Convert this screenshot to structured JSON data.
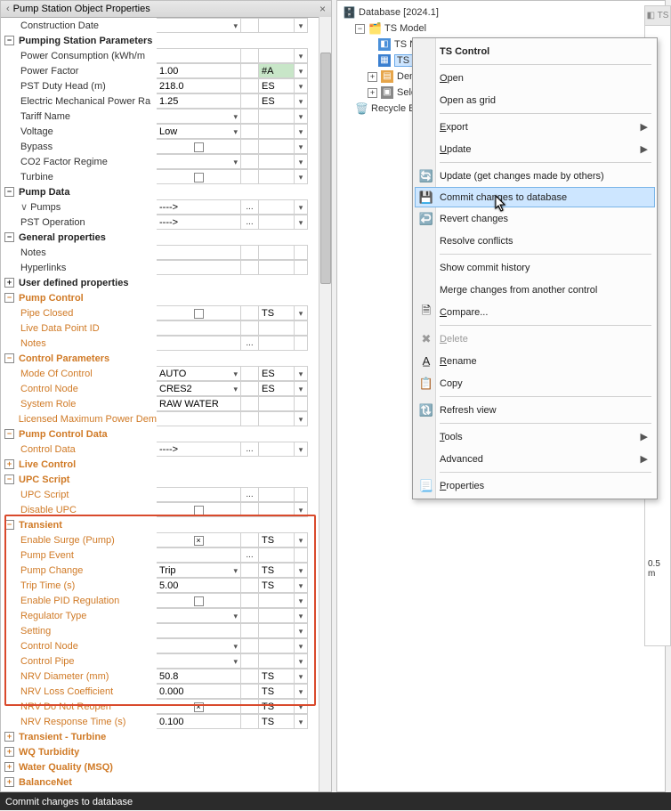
{
  "panel_title": "Pump Station Object Properties",
  "rows": [
    {
      "type": "field",
      "label": "Construction Date",
      "c1": "",
      "c1dd": true,
      "c2": "",
      "c3": "",
      "c4": true
    },
    {
      "type": "group",
      "label": "Pumping Station Parameters",
      "exp": "−"
    },
    {
      "type": "field",
      "label": "Power Consumption (kWh/m",
      "c1": "",
      "c2": "",
      "c3": "",
      "c4": true
    },
    {
      "type": "field",
      "label": "Power Factor",
      "c1": "1.00",
      "c2": "",
      "c3": "#A",
      "c3cls": "green",
      "c4": true
    },
    {
      "type": "field",
      "label": "PST Duty Head (m)",
      "c1": "218.0",
      "c2": "",
      "c3": "ES",
      "c4": true
    },
    {
      "type": "field",
      "label": "Electric Mechanical Power Ra",
      "c1": "1.25",
      "c2": "",
      "c3": "ES",
      "c4": true
    },
    {
      "type": "field",
      "label": "Tariff Name",
      "c1": "",
      "c1dd": true,
      "c2": "",
      "c3": "",
      "c4": true
    },
    {
      "type": "field",
      "label": "Voltage",
      "c1": "Low",
      "c1dd": true,
      "c2": "",
      "c3": "",
      "c4": true
    },
    {
      "type": "field",
      "label": "Bypass",
      "c1": "",
      "check": true,
      "c2": "",
      "c3": "",
      "c4": true
    },
    {
      "type": "field",
      "label": "CO2 Factor Regime",
      "c1": "",
      "c1dd": true,
      "c2": "",
      "c3": "",
      "c4": true
    },
    {
      "type": "field",
      "label": "Turbine",
      "c1": "",
      "check": true,
      "c2": "",
      "c3": "",
      "c4": true
    },
    {
      "type": "group",
      "label": "Pump Data",
      "exp": "−"
    },
    {
      "type": "field",
      "label": "Pumps",
      "expander": true,
      "c1": "---->",
      "c2": "...",
      "c3": "",
      "c4": true
    },
    {
      "type": "field",
      "label": "PST Operation",
      "c1": "---->",
      "c2": "...",
      "c3": "",
      "c4": true
    },
    {
      "type": "group",
      "label": "General properties",
      "exp": "−"
    },
    {
      "type": "field",
      "label": "Notes",
      "c1": "",
      "c2": "",
      "c3": "",
      "c4": ""
    },
    {
      "type": "field",
      "label": "Hyperlinks",
      "c1": "",
      "c2": "",
      "c3": "",
      "c4": ""
    },
    {
      "type": "group",
      "label": "User defined properties",
      "exp": "+"
    },
    {
      "type": "group",
      "label": "Pump Control",
      "exp": "−",
      "orange": true
    },
    {
      "type": "field",
      "label": "Pipe Closed",
      "orange": true,
      "c1": "",
      "check": true,
      "c2": "",
      "c3": "TS",
      "c4": true
    },
    {
      "type": "field",
      "label": "Live Data Point ID",
      "orange": true,
      "c1": "",
      "c2": "",
      "c3": "",
      "c4": ""
    },
    {
      "type": "field",
      "label": "Notes",
      "orange": true,
      "c1": "",
      "c2": "...",
      "c3": "",
      "c4": ""
    },
    {
      "type": "group",
      "label": "Control Parameters",
      "exp": "−",
      "orange": true
    },
    {
      "type": "field",
      "label": "Mode Of Control",
      "orange": true,
      "c1": "AUTO",
      "c1dd": true,
      "c2": "",
      "c3": "ES",
      "c4": true
    },
    {
      "type": "field",
      "label": "Control Node",
      "orange": true,
      "c1": "CRES2",
      "c1dd": true,
      "c2": "",
      "c3": "ES",
      "c4": true
    },
    {
      "type": "field",
      "label": "System Role",
      "orange": true,
      "c1": "RAW WATER",
      "c2": "",
      "c3": "",
      "c4": ""
    },
    {
      "type": "field",
      "label": "Licensed Maximum Power Dem",
      "orange": true,
      "c1": "",
      "c2": "",
      "c3": "",
      "c4": true
    },
    {
      "type": "group",
      "label": "Pump Control Data",
      "exp": "−",
      "orange": true
    },
    {
      "type": "field",
      "label": "Control Data",
      "orange": true,
      "c1": "---->",
      "c2": "...",
      "c3": "",
      "c4": true
    },
    {
      "type": "group",
      "label": "Live Control",
      "exp": "+",
      "orange": true
    },
    {
      "type": "group",
      "label": "UPC Script",
      "exp": "−",
      "orange": true
    },
    {
      "type": "field",
      "label": "UPC Script",
      "orange": true,
      "c1": "",
      "c2": "...",
      "c3": "",
      "c4": ""
    },
    {
      "type": "field",
      "label": "Disable UPC",
      "orange": true,
      "c1": "",
      "check": true,
      "c2": "",
      "c3": "",
      "c4": true
    },
    {
      "type": "group",
      "label": "Transient",
      "exp": "−",
      "orange": true
    },
    {
      "type": "field",
      "label": "Enable Surge (Pump)",
      "orange": true,
      "c1": "",
      "check": true,
      "checked": true,
      "c2": "",
      "c3": "TS",
      "c4": true
    },
    {
      "type": "field",
      "label": "Pump Event",
      "orange": true,
      "c1": "",
      "c2": "...",
      "c3": "",
      "c4": ""
    },
    {
      "type": "field",
      "label": "Pump Change",
      "orange": true,
      "c1": "Trip",
      "c1dd": true,
      "c2": "",
      "c3": "TS",
      "c4": true
    },
    {
      "type": "field",
      "label": "Trip Time (s)",
      "orange": true,
      "c1": "5.00",
      "c2": "",
      "c3": "TS",
      "c4": true
    },
    {
      "type": "field",
      "label": "Enable PID Regulation",
      "orange": true,
      "c1": "",
      "check": true,
      "c2": "",
      "c3": "",
      "c4": true
    },
    {
      "type": "field",
      "label": "Regulator Type",
      "orange": true,
      "c1": "",
      "c1dd": true,
      "c2": "",
      "c3": "",
      "c4": true
    },
    {
      "type": "field",
      "label": "Setting",
      "orange": true,
      "c1": "",
      "c2": "",
      "c3": "",
      "c4": true
    },
    {
      "type": "field",
      "label": "Control Node",
      "orange": true,
      "c1": "",
      "c1dd": true,
      "c2": "",
      "c3": "",
      "c4": true
    },
    {
      "type": "field",
      "label": "Control Pipe",
      "orange": true,
      "c1": "",
      "c1dd": true,
      "c2": "",
      "c3": "",
      "c4": true
    },
    {
      "type": "field",
      "label": "NRV Diameter (mm)",
      "orange": true,
      "c1": "50.8",
      "c2": "",
      "c3": "TS",
      "c4": true
    },
    {
      "type": "field",
      "label": "NRV Loss Coefficient",
      "orange": true,
      "c1": "0.000",
      "c2": "",
      "c3": "TS",
      "c4": true
    },
    {
      "type": "field",
      "label": "NRV Do Not Reopen",
      "orange": true,
      "c1": "",
      "check": true,
      "checked": true,
      "c2": "",
      "c3": "TS",
      "c4": true
    },
    {
      "type": "field",
      "label": "NRV Response Time (s)",
      "orange": true,
      "c1": "0.100",
      "c2": "",
      "c3": "TS",
      "c4": true
    },
    {
      "type": "group",
      "label": "Transient - Turbine",
      "exp": "+",
      "orange": true
    },
    {
      "type": "group",
      "label": "WQ Turbidity",
      "exp": "+",
      "orange": true
    },
    {
      "type": "group",
      "label": "Water Quality (MSQ)",
      "exp": "+",
      "orange": true
    },
    {
      "type": "group",
      "label": "BalanceNet",
      "exp": "+",
      "orange": true
    }
  ],
  "tree": {
    "root": "Database [2024.1]",
    "model": "TS Model",
    "items": [
      "TS Ne",
      "TS Co",
      "Dema",
      "Select"
    ],
    "bin": "Recycle Bin"
  },
  "menu": [
    {
      "label": "TS Control",
      "bold": true
    },
    {
      "sep": true
    },
    {
      "label": "Open",
      "u": "O"
    },
    {
      "label": "Open as grid"
    },
    {
      "sep": true
    },
    {
      "label": "Export",
      "arrow": true,
      "u": "E"
    },
    {
      "label": "Update",
      "arrow": true,
      "u": "U"
    },
    {
      "sep": true
    },
    {
      "label": "Update (get changes made by others)",
      "icon": "🔄"
    },
    {
      "label": "Commit changes to database",
      "icon": "💾",
      "hl": true
    },
    {
      "label": "Revert changes",
      "icon": "↩️"
    },
    {
      "label": "Resolve conflicts"
    },
    {
      "sep": true
    },
    {
      "label": "Show commit history"
    },
    {
      "label": "Merge changes from another control"
    },
    {
      "label": "Compare...",
      "icon": "🗎",
      "u": "C"
    },
    {
      "sep": true
    },
    {
      "label": "Delete",
      "disabled": true,
      "icon": "✖",
      "u": "D"
    },
    {
      "label": "Rename",
      "icon": "A̲",
      "u": "R"
    },
    {
      "label": "Copy",
      "icon": "📋"
    },
    {
      "sep": true
    },
    {
      "label": "Refresh view",
      "icon": "🔃"
    },
    {
      "sep": true
    },
    {
      "label": "Tools",
      "arrow": true,
      "u": "T"
    },
    {
      "label": "Advanced",
      "arrow": true
    },
    {
      "sep": true
    },
    {
      "label": "Properties",
      "icon": "📃",
      "u": "P"
    }
  ],
  "status": "Commit changes to database",
  "frag_tab": "◧ TS",
  "frag_scale": "0.5 m"
}
